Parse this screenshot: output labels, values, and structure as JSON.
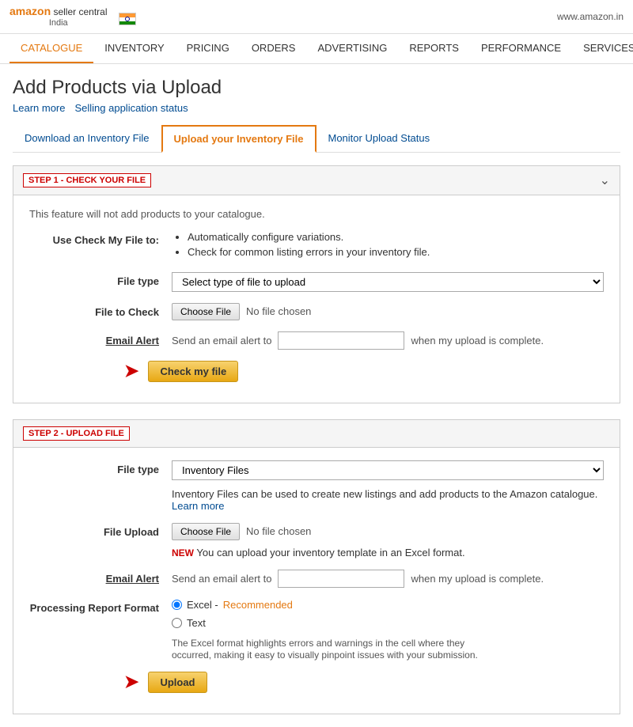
{
  "topbar": {
    "logo_line1": "amazon seller central",
    "logo_line2": "India",
    "domain": "www.amazon.in"
  },
  "nav": {
    "items": [
      {
        "label": "CATALOGUE",
        "active": true
      },
      {
        "label": "INVENTORY",
        "active": false
      },
      {
        "label": "PRICING",
        "active": false
      },
      {
        "label": "ORDERS",
        "active": false
      },
      {
        "label": "ADVERTISING",
        "active": false
      },
      {
        "label": "REPORTS",
        "active": false
      },
      {
        "label": "PERFORMANCE",
        "active": false
      },
      {
        "label": "SERVICES",
        "active": false
      }
    ]
  },
  "page": {
    "title": "Add Products via Upload",
    "learn_more": "Learn more",
    "selling_status": "Selling application status"
  },
  "tabs": [
    {
      "label": "Download an Inventory File",
      "active": false
    },
    {
      "label": "Upload your Inventory File",
      "active": true
    },
    {
      "label": "Monitor Upload Status",
      "active": false
    }
  ],
  "step1": {
    "badge": "STEP 1 - CHECK YOUR FILE",
    "feature_note": "This feature will not add products to your catalogue.",
    "use_label": "Use Check My File to:",
    "bullets": [
      "Automatically configure variations.",
      "Check for common listing errors in your inventory file."
    ],
    "file_type_label": "File type",
    "file_type_placeholder": "Select type of file to upload",
    "file_to_check_label": "File to Check",
    "choose_file_btn": "Choose File",
    "no_file_text": "No file chosen",
    "email_alert_label": "Email Alert",
    "email_send_text": "Send an email alert to",
    "email_when_text": "when my upload is complete.",
    "check_btn": "Check my file"
  },
  "step2": {
    "badge": "STEP 2 - UPLOAD FILE",
    "file_type_label": "File type",
    "file_type_value": "Inventory Files",
    "inventory_desc": "Inventory Files can be used to create new listings and add products to the Amazon catalogue.",
    "learn_more": "Learn more",
    "file_upload_label": "File Upload",
    "choose_file_btn": "Choose File",
    "no_file_text": "No file chosen",
    "new_badge": "NEW",
    "new_text": "You can upload your inventory template in an Excel format.",
    "email_alert_label": "Email Alert",
    "email_send_text": "Send an email alert to",
    "email_when_text": "when my upload is complete.",
    "processing_label": "Processing Report Format",
    "radio_excel": "Excel -",
    "radio_excel_recommended": "Recommended",
    "radio_text": "Text",
    "processing_desc": "The Excel format highlights errors and warnings in the cell where they occurred, making it easy to visually pinpoint issues with your submission.",
    "upload_btn": "Upload"
  }
}
